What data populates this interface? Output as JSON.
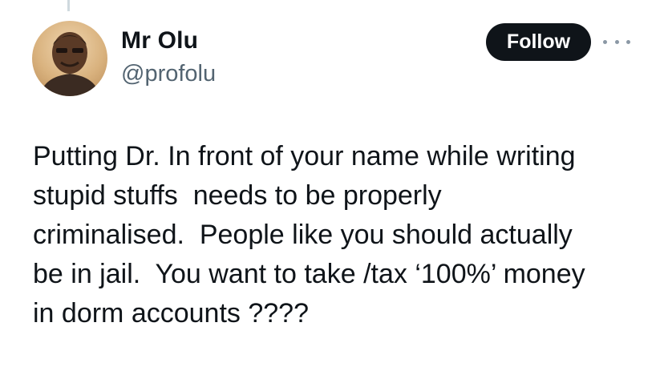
{
  "author": {
    "display_name": "Mr Olu",
    "handle": "@profolu",
    "avatar_icon": "profile-photo-avatar"
  },
  "actions": {
    "follow_label": "Follow",
    "more_icon": "more-dots-icon"
  },
  "tweet": {
    "lines": [
      "Putting Dr. In front of your name while writing",
      "stupid stuffs  needs to be properly",
      "criminalised.  People like you should actually",
      "be in jail.  You want to take /tax ‘100%’ money",
      "in dorm accounts ????"
    ]
  },
  "colors": {
    "text": "#0f1419",
    "handle": "#536471",
    "follow_bg": "#0f1419",
    "follow_text": "#ffffff",
    "thread_line": "#cfd9de"
  }
}
